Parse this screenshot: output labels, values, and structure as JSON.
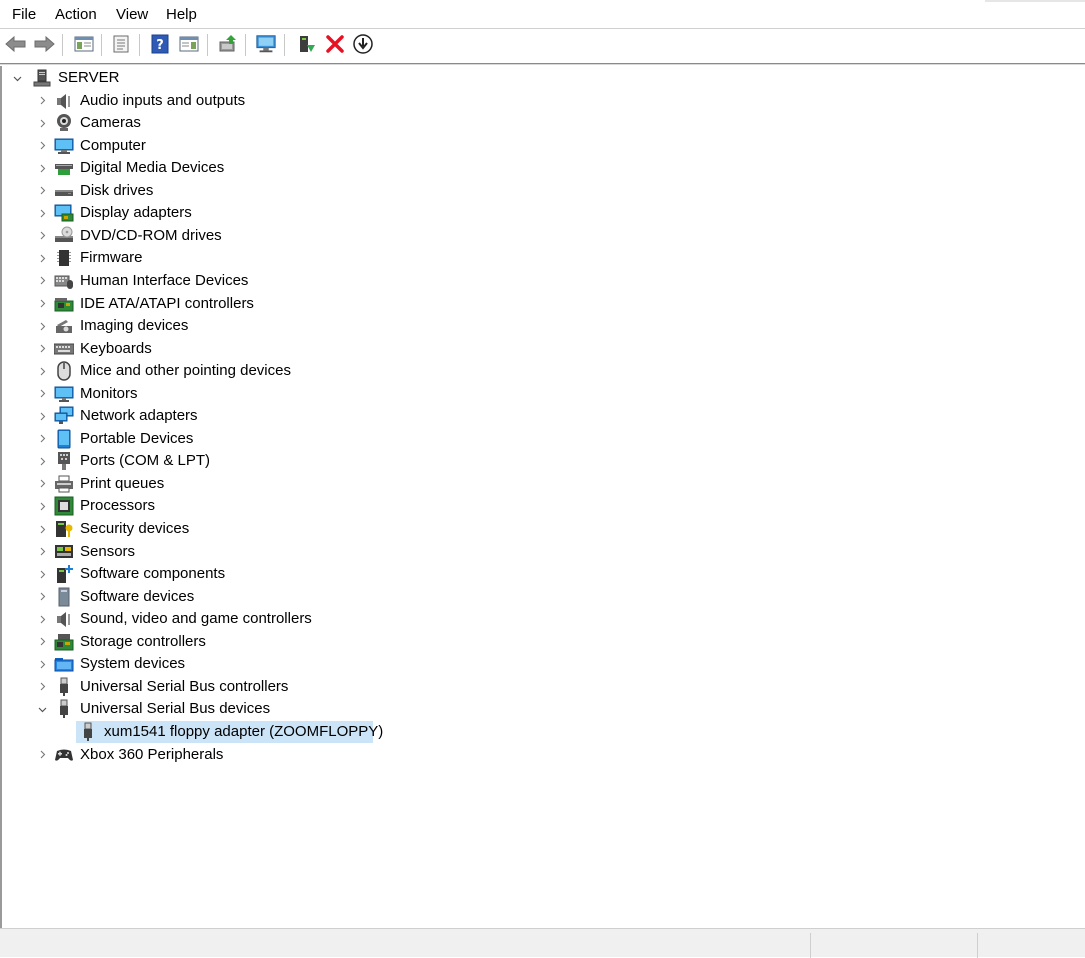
{
  "menu": [
    "File",
    "Action",
    "View",
    "Help"
  ],
  "toolbar": {
    "buttons": [
      "back-icon",
      "forward-icon",
      "show-hide-console-tree-icon",
      "properties-icon",
      "help-icon",
      "show-action-pane-icon",
      "update-driver-icon",
      "scan-hardware-icon",
      "enable-device-icon",
      "uninstall-device-icon",
      "download-icon"
    ]
  },
  "tree": {
    "root": "SERVER",
    "categories": [
      {
        "label": "Audio inputs and outputs",
        "icon": "speaker-icon"
      },
      {
        "label": "Cameras",
        "icon": "camera-icon"
      },
      {
        "label": "Computer",
        "icon": "computer-icon"
      },
      {
        "label": "Digital Media Devices",
        "icon": "media-device-icon"
      },
      {
        "label": "Disk drives",
        "icon": "disk-drive-icon"
      },
      {
        "label": "Display adapters",
        "icon": "display-adapter-icon"
      },
      {
        "label": "DVD/CD-ROM drives",
        "icon": "dvd-drive-icon"
      },
      {
        "label": "Firmware",
        "icon": "firmware-icon"
      },
      {
        "label": "Human Interface Devices",
        "icon": "hid-icon"
      },
      {
        "label": "IDE ATA/ATAPI controllers",
        "icon": "ide-controller-icon"
      },
      {
        "label": "Imaging devices",
        "icon": "imaging-icon"
      },
      {
        "label": "Keyboards",
        "icon": "keyboard-icon"
      },
      {
        "label": "Mice and other pointing devices",
        "icon": "mouse-icon"
      },
      {
        "label": "Monitors",
        "icon": "monitor-icon"
      },
      {
        "label": "Network adapters",
        "icon": "network-icon"
      },
      {
        "label": "Portable Devices",
        "icon": "portable-device-icon"
      },
      {
        "label": "Ports (COM & LPT)",
        "icon": "port-icon"
      },
      {
        "label": "Print queues",
        "icon": "printer-icon"
      },
      {
        "label": "Processors",
        "icon": "processor-icon"
      },
      {
        "label": "Security devices",
        "icon": "security-icon"
      },
      {
        "label": "Sensors",
        "icon": "sensor-icon"
      },
      {
        "label": "Software components",
        "icon": "software-component-icon"
      },
      {
        "label": "Software devices",
        "icon": "software-device-icon"
      },
      {
        "label": "Sound, video and game controllers",
        "icon": "speaker-icon"
      },
      {
        "label": "Storage controllers",
        "icon": "storage-controller-icon"
      },
      {
        "label": "System devices",
        "icon": "system-folder-icon"
      },
      {
        "label": "Universal Serial Bus controllers",
        "icon": "usb-icon"
      },
      {
        "label": "Universal Serial Bus devices",
        "icon": "usb-icon",
        "expanded": true,
        "children": [
          {
            "label": "xum1541 floppy adapter (ZOOMFLOPPY)",
            "icon": "usb-icon",
            "selected": true
          }
        ]
      },
      {
        "label": "Xbox 360 Peripherals",
        "icon": "gamepad-icon"
      }
    ]
  },
  "colors": {
    "selection": "#cce4f7",
    "accent": "#0078d4",
    "uninstall": "#e81123"
  }
}
